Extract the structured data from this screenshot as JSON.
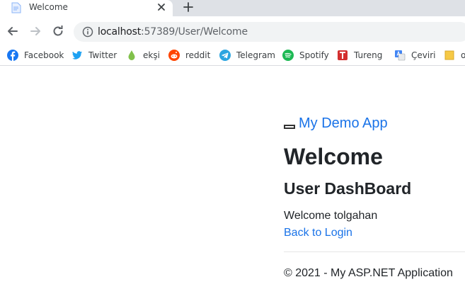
{
  "browser": {
    "tab": {
      "title": "Welcome",
      "favicon": "page-icon"
    },
    "new_tab_icon": "plus-icon",
    "address": {
      "host": "localhost",
      "path": ":57389/User/Welcome"
    },
    "bookmarks": [
      {
        "label": "Facebook",
        "icon": "facebook-icon",
        "color": "#1877f2"
      },
      {
        "label": "Twitter",
        "icon": "twitter-icon",
        "color": "#1da1f2"
      },
      {
        "label": "ekşi",
        "icon": "eksi-drop-icon",
        "color": "#81c14b"
      },
      {
        "label": "reddit",
        "icon": "reddit-icon",
        "color": "#ff4500"
      },
      {
        "label": "Telegram",
        "icon": "telegram-icon",
        "color": "#2ca5e0"
      },
      {
        "label": "Spotify",
        "icon": "spotify-icon",
        "color": "#1db954"
      },
      {
        "label": "Tureng",
        "icon": "tureng-icon",
        "color": "#d32f2f"
      },
      {
        "label": "Çeviri",
        "icon": "translate-icon",
        "color": "#4285f4"
      },
      {
        "label": "o",
        "icon": "folder-icon",
        "color": "#f6c945"
      }
    ]
  },
  "page": {
    "brand": "My Demo App",
    "title": "Welcome",
    "subtitle": "User DashBoard",
    "welcome_text": "Welcome tolgahan",
    "back_link": "Back to Login",
    "footer": "© 2021 - My ASP.NET Application"
  },
  "colors": {
    "link": "#1a73e8",
    "text": "#212529",
    "chrome_bg": "#dee1e6",
    "omnibox_bg": "#f1f3f4"
  }
}
